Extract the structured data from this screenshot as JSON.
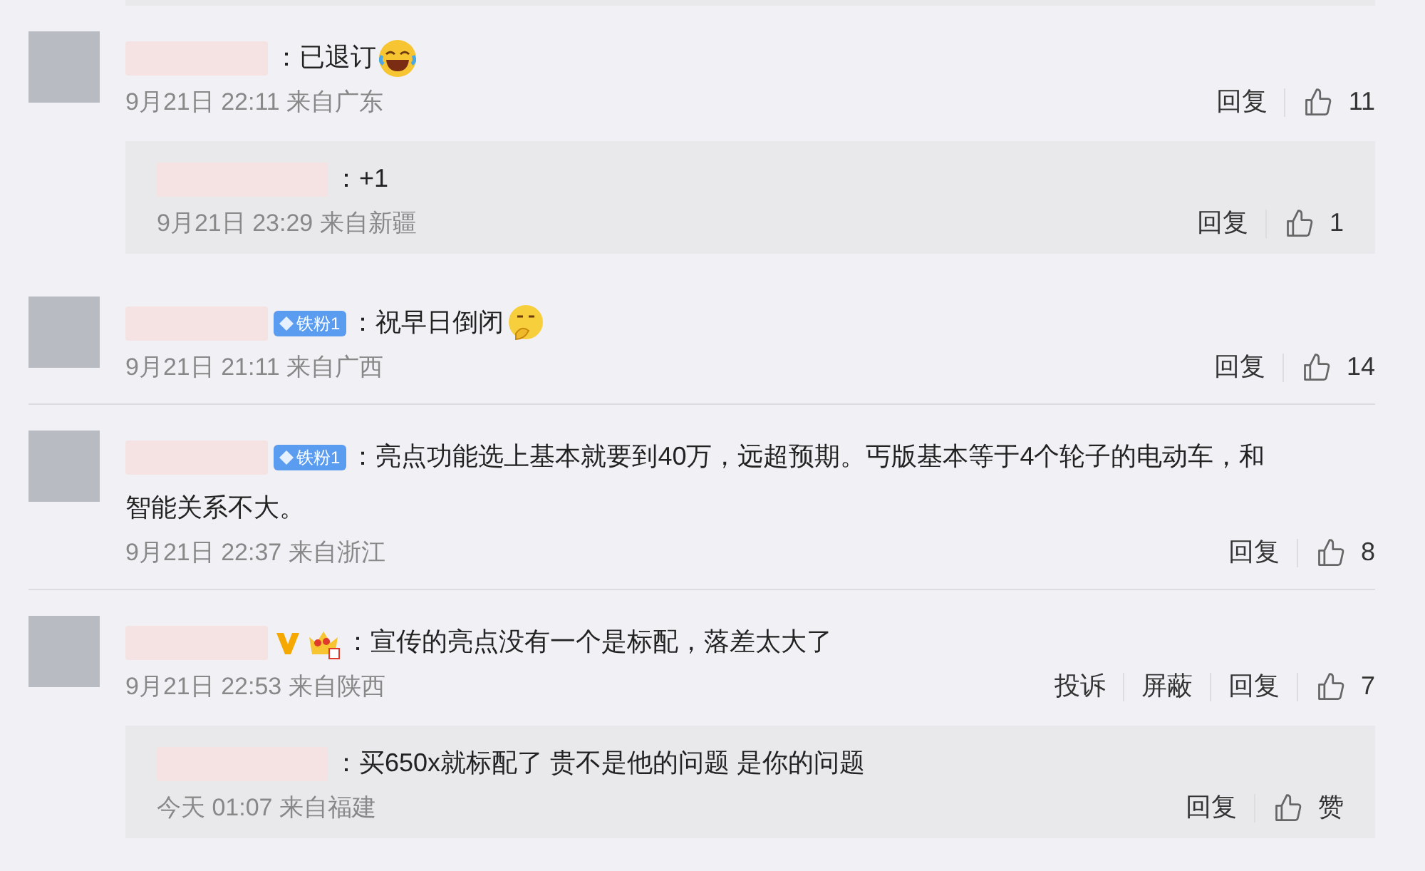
{
  "comments": [
    {
      "text": "：已退订",
      "emojis": [
        {
          "kind": "laughing"
        }
      ],
      "time": "9月21日 22:11 来自广东",
      "actions": [
        "回复"
      ],
      "likes": "11",
      "replies": [
        {
          "text": "：+1",
          "time": "9月21日 23:29 来自新疆",
          "actions": [
            "回复"
          ],
          "likes": "1"
        }
      ]
    },
    {
      "badges": [
        {
          "kind": "fan",
          "label": "铁粉1"
        }
      ],
      "text": "：祝早日倒闭",
      "emojis": [
        {
          "kind": "shy"
        }
      ],
      "time": "9月21日 21:11 来自广西",
      "actions": [
        "回复"
      ],
      "likes": "14"
    },
    {
      "badges": [
        {
          "kind": "fan",
          "label": "铁粉1"
        }
      ],
      "text": "：亮点功能选上基本就要到40万，远超预期。丐版基本等于4个轮子的电动车，和",
      "text_continued": "智能关系不大。",
      "time": "9月21日 22:37 来自浙江",
      "actions": [
        "回复"
      ],
      "likes": "8"
    },
    {
      "badges": [
        {
          "kind": "verified"
        },
        {
          "kind": "crown"
        }
      ],
      "text": "：宣传的亮点没有一个是标配，落差太大了",
      "time": "9月21日 22:53 来自陕西",
      "actions": [
        "投诉",
        "屏蔽",
        "回复"
      ],
      "likes": "7",
      "replies": [
        {
          "text": "：买650x就标配了 贵不是他的问题 是你的问题",
          "time": "今天 01:07 来自福建",
          "actions": [
            "回复"
          ],
          "likes": "赞"
        }
      ]
    }
  ]
}
